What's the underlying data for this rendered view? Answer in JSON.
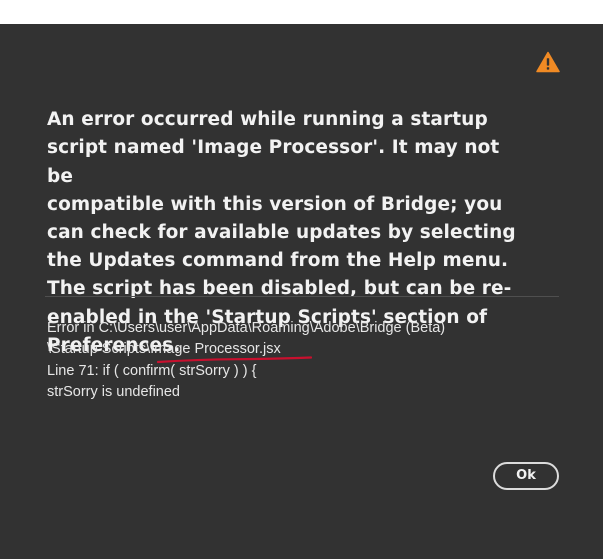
{
  "dialog": {
    "message_lines": [
      "An error occurred while running a startup",
      "script named 'Image Processor'.  It may not be",
      "compatible with this version of Bridge; you",
      "can check for available updates by selecting",
      "the Updates command from the Help menu.",
      "The script has been disabled, but can be re-",
      "enabled in the 'Startup Scripts' section of",
      "Preferences."
    ],
    "icon": "warning-icon",
    "details": {
      "path_line1": "Error in C:\\Users\\user\\AppData\\Roaming\\Adobe\\Bridge (Beta)",
      "path_line2_prefix": "\\Startup Scripts\\",
      "path_line2_file": "Image Processor.jsx",
      "code_line": "Line 71: if ( confirm( strSorry ) ) {",
      "error_line": "strSorry is undefined"
    },
    "ok_label": "Ok"
  },
  "colors": {
    "dialog_background": "#323232",
    "text": "#f2f2f2",
    "warning": "#f08a24",
    "annotation_underline": "#c8102e"
  }
}
